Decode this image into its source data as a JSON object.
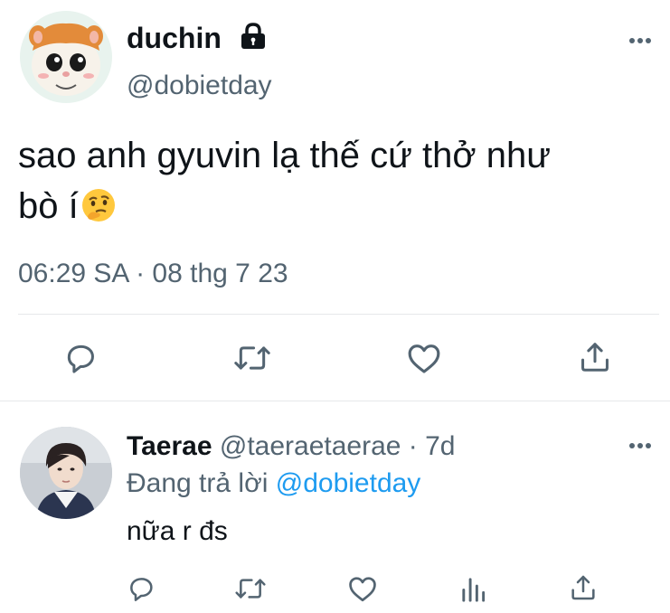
{
  "tweet": {
    "display_name": "duchin",
    "handle": "@dobietday",
    "text_line1": "sao anh gyuvin lạ thế cứ thở như",
    "text_line2": "bò í",
    "emoji": "thinking-face",
    "timestamp": "06:29 SA · 08 thg 7 23",
    "lock_icon": "lock-icon",
    "more_icon": "more-horizontal-icon"
  },
  "actions": {
    "reply_icon": "reply-icon",
    "retweet_icon": "retweet-icon",
    "like_icon": "like-icon",
    "share_icon": "share-icon"
  },
  "reply": {
    "display_name": "Taerae",
    "handle": "@taeraetaerae",
    "time": "· 7d",
    "replying_prefix": "Đang trả lời",
    "replying_handle": "@dobietday",
    "text": "nữa r đs",
    "more_icon": "more-horizontal-icon"
  },
  "reply_actions": {
    "reply_icon": "reply-icon",
    "retweet_icon": "retweet-icon",
    "like_icon": "like-icon",
    "analytics_icon": "analytics-icon",
    "share_icon": "share-icon"
  },
  "colors": {
    "accent": "#1d9bf0",
    "text": "#0f1419",
    "muted": "#536471",
    "divider": "#e6e8ea"
  }
}
